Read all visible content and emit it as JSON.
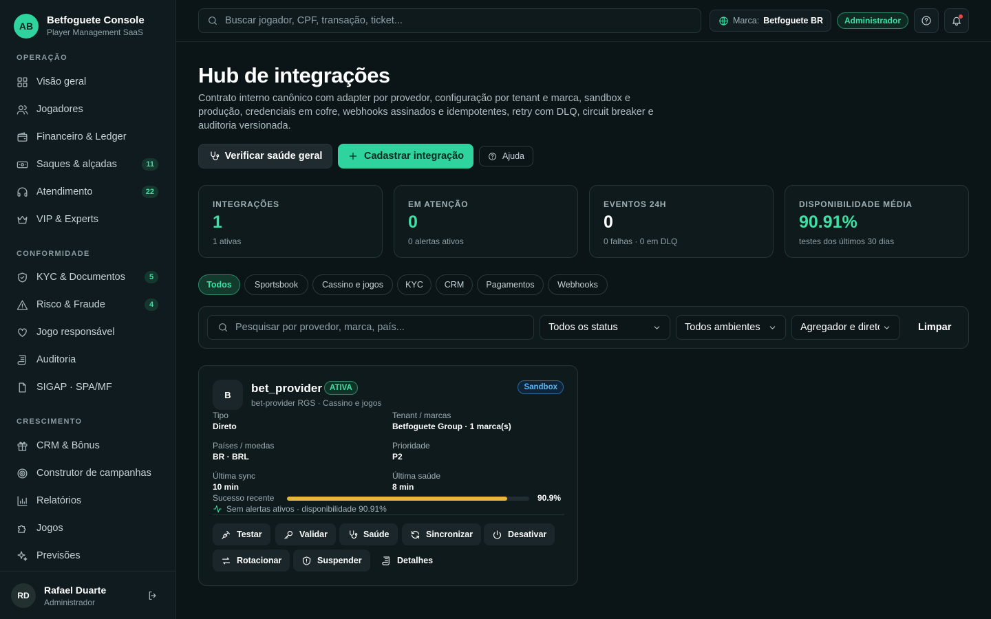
{
  "brand": {
    "initials": "AB",
    "name": "Betfoguete Console",
    "subtitle": "Player Management SaaS"
  },
  "sidebar": {
    "sections": [
      {
        "title": "OPERAÇÃO"
      },
      {
        "title": "CONFORMIDADE"
      },
      {
        "title": "CRESCIMENTO"
      }
    ],
    "items": [
      {
        "label": "Visão geral",
        "icon": "grid-icon"
      },
      {
        "label": "Jogadores",
        "icon": "users-icon"
      },
      {
        "label": "Financeiro & Ledger",
        "icon": "wallet-icon"
      },
      {
        "label": "Saques & alçadas",
        "icon": "banknote-icon",
        "badge": "11"
      },
      {
        "label": "Atendimento",
        "icon": "headset-icon",
        "badge": "22"
      },
      {
        "label": "VIP & Experts",
        "icon": "crown-icon"
      },
      {
        "label": "KYC & Documentos",
        "icon": "shield-check-icon",
        "badge": "5"
      },
      {
        "label": "Risco & Fraude",
        "icon": "alert-triangle-icon",
        "badge": "4"
      },
      {
        "label": "Jogo responsável",
        "icon": "heart-hand-icon"
      },
      {
        "label": "Auditoria",
        "icon": "scroll-icon"
      },
      {
        "label": "SIGAP · SPA/MF",
        "icon": "file-icon"
      },
      {
        "label": "CRM & Bônus",
        "icon": "gift-icon"
      },
      {
        "label": "Construtor de campanhas",
        "icon": "target-icon"
      },
      {
        "label": "Relatórios",
        "icon": "bar-chart-icon"
      },
      {
        "label": "Jogos",
        "icon": "puzzle-icon"
      },
      {
        "label": "Previsões",
        "icon": "sparkles-icon"
      }
    ],
    "user": {
      "initials": "RD",
      "name": "Rafael Duarte",
      "role": "Administrador"
    }
  },
  "topbar": {
    "search_placeholder": "Buscar jogador, CPF, transação, ticket...",
    "brand_label": "Marca:",
    "brand_value": "Betfoguete BR",
    "role": "Administrador"
  },
  "page": {
    "title": "Hub de integrações",
    "description": "Contrato interno canônico com adapter por provedor, configuração por tenant e marca, sandbox e produção, credenciais em cofre, webhooks assinados e idempotentes, retry com DLQ, circuit breaker e auditoria versionada.",
    "actions": {
      "health_check": "Verificar saúde geral",
      "register": "Cadastrar integração",
      "help": "Ajuda"
    }
  },
  "stats": [
    {
      "label": "INTEGRAÇÕES",
      "value": "1",
      "sub": "1 ativas"
    },
    {
      "label": "EM ATENÇÃO",
      "value": "0",
      "sub": "0 alertas ativos"
    },
    {
      "label": "EVENTOS 24H",
      "value": "0",
      "sub": "0 falhas · 0 em DLQ"
    },
    {
      "label": "DISPONIBILIDADE MÉDIA",
      "value": "90.91%",
      "sub": "testes dos últimos 30 dias"
    }
  ],
  "categories": [
    "Todos",
    "Sportsbook",
    "Cassino e jogos",
    "KYC",
    "CRM",
    "Pagamentos",
    "Webhooks"
  ],
  "filters": {
    "search_placeholder": "Pesquisar por provedor, marca, país...",
    "status": "Todos os status",
    "environment": "Todos ambientes",
    "type": "Agregador e direto",
    "clear": "Limpar"
  },
  "integration": {
    "initial": "B",
    "name": "bet_provider",
    "status": "ATIVA",
    "environment": "Sandbox",
    "subtitle": "bet-provider RGS · Cassino e jogos",
    "fields": {
      "type_label": "Tipo",
      "type_value": "Direto",
      "tenant_label": "Tenant / marcas",
      "tenant_value": "Betfoguete Group · 1 marca(s)",
      "countries_label": "Países / moedas",
      "countries_value": "BR · BRL",
      "priority_label": "Prioridade",
      "priority_value": "P2",
      "last_sync_label": "Última sync",
      "last_sync_value": "10 min",
      "last_health_label": "Última saúde",
      "last_health_value": "8 min"
    },
    "success_label": "Sucesso recente",
    "success_value": "90.9%",
    "success_fraction": 0.909,
    "health_note": "Sem alertas ativos · disponibilidade 90.91%",
    "actions": [
      "Testar",
      "Validar",
      "Saúde",
      "Sincronizar",
      "Desativar",
      "Rotacionar",
      "Suspender",
      "Detalhes"
    ]
  },
  "colors": {
    "accent": "#2fd39e",
    "warning": "#e8b63c",
    "sandbox": "#5cb4f2"
  }
}
